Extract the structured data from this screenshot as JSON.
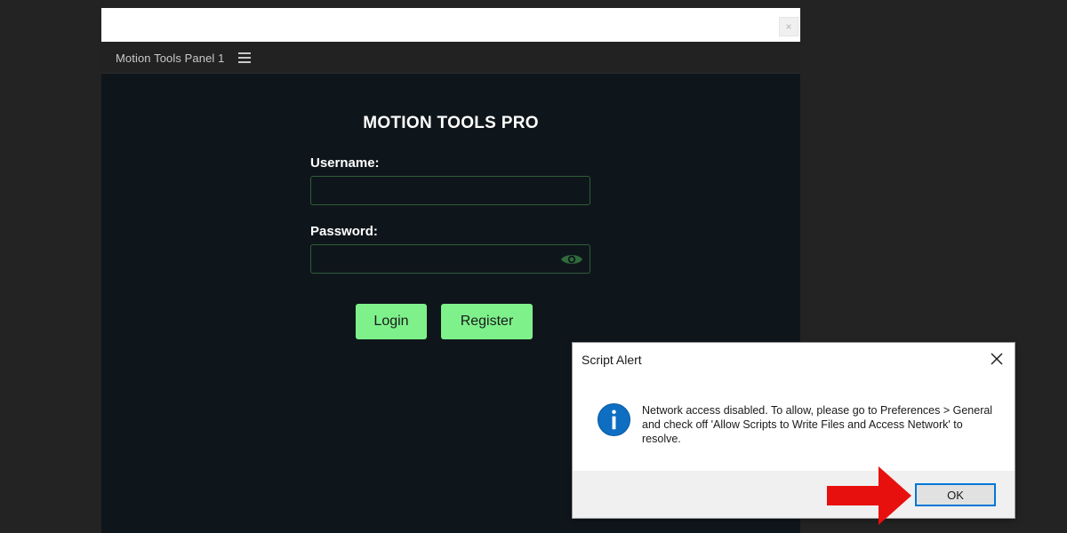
{
  "panel": {
    "tab_title": "Motion Tools Panel 1",
    "close_glyph": "×"
  },
  "login": {
    "title": "MOTION TOOLS PRO",
    "username_label": "Username:",
    "username_value": "",
    "password_label": "Password:",
    "password_value": "",
    "login_button": "Login",
    "register_button": "Register"
  },
  "alert": {
    "title": "Script Alert",
    "message": "Network access disabled. To allow, please go to Preferences > General and check off 'Allow Scripts to Write Files and Access Network' to resolve.",
    "ok_button": "OK"
  },
  "icons": {
    "panel_menu": "hamburger-icon",
    "password_toggle": "eye-icon",
    "alert_info": "info-icon",
    "alert_close": "close-icon",
    "annotation": "red-arrow-icon"
  },
  "colors": {
    "background": "#232323",
    "panel_bg": "#0f161b",
    "accent_green": "#7ef18b",
    "input_border": "#2f5c38",
    "info_blue": "#0d6ec2",
    "ok_focus": "#0078d7",
    "arrow_red": "#e8100e"
  }
}
